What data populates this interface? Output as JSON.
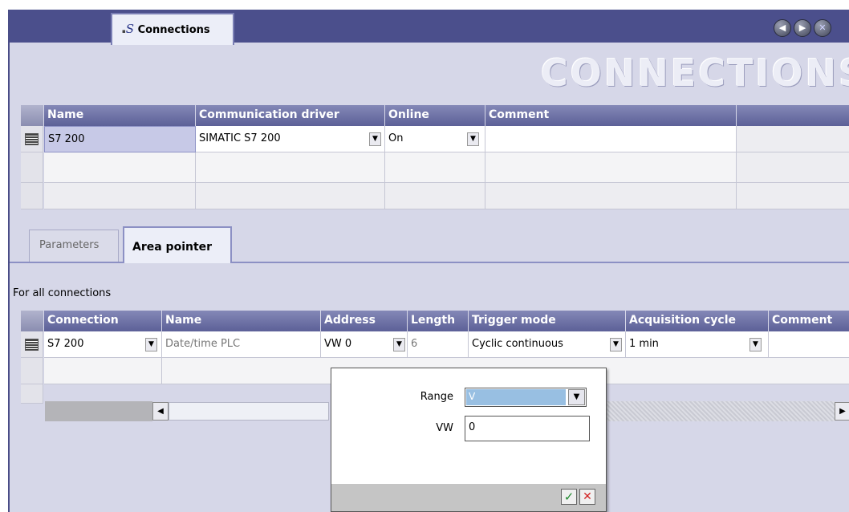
{
  "window": {
    "tab_title": "Connections",
    "heading": "CONNECTIONS",
    "nav": {
      "prev_glyph": "◀",
      "next_glyph": "▶",
      "close_glyph": "✕"
    }
  },
  "connections_table": {
    "columns": [
      "Name",
      "Communication driver",
      "Online",
      "Comment"
    ],
    "rows": [
      {
        "name": "S7 200",
        "driver": "SIMATIC S7 200",
        "online": "On",
        "comment": ""
      }
    ]
  },
  "tabs": {
    "parameters": "Parameters",
    "area_pointer": "Area pointer"
  },
  "area_pointer": {
    "section_label": "For all connections",
    "columns": [
      "Connection",
      "Name",
      "Address",
      "Length",
      "Trigger mode",
      "Acquisition cycle",
      "Comment"
    ],
    "rows": [
      {
        "connection": "S7 200",
        "name": "Date/time PLC",
        "address": "VW 0",
        "length": "6",
        "trigger_mode": "Cyclic continuous",
        "acquisition_cycle": "1 min",
        "comment": ""
      }
    ]
  },
  "address_popup": {
    "range_label": "Range",
    "range_value": "V",
    "vw_label": "VW",
    "vw_value": "0",
    "ok_glyph": "✓",
    "cancel_glyph": "✕"
  },
  "glyphs": {
    "dropdown": "▼",
    "scroll_left": "◀",
    "scroll_right": "▶"
  },
  "colors": {
    "titlebar": "#4b4f8c",
    "background": "#d6d7e8",
    "header": "#5c6097",
    "selection": "#c7c9e7"
  }
}
